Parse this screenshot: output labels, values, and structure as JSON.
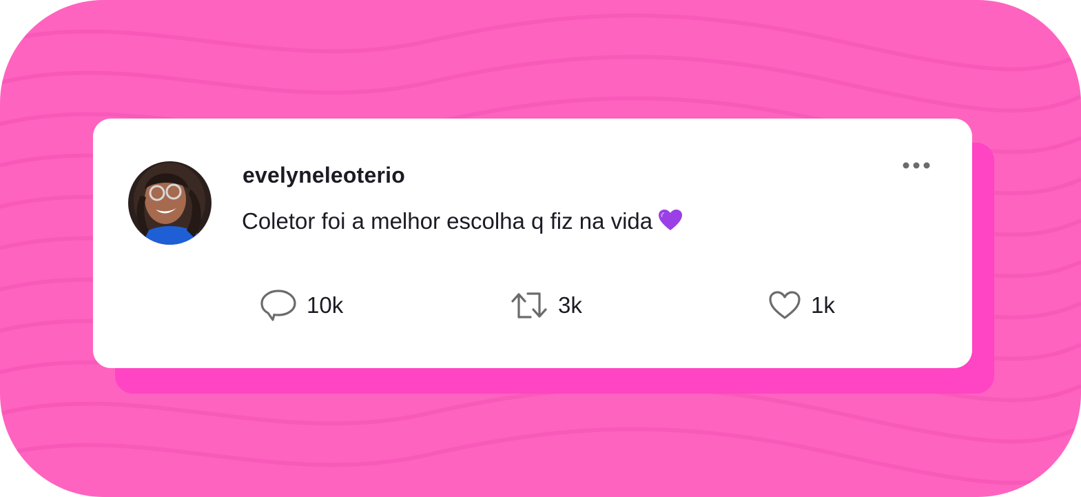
{
  "post": {
    "username": "evelyneleoterio",
    "text": "Coletor foi a melhor escolha q fiz na vida",
    "emoji_icon": "purple-heart-icon",
    "avatar_icon": "profile-photo",
    "more_icon": "more-options-icon"
  },
  "actions": {
    "replies": {
      "icon": "comment-icon",
      "count": "10k"
    },
    "reposts": {
      "icon": "repost-icon",
      "count": "3k"
    },
    "likes": {
      "icon": "heart-icon",
      "count": "1k"
    }
  },
  "colors": {
    "background": "#ff63c0",
    "card_shadow": "#ff44c4",
    "card": "#ffffff",
    "text": "#1b1b24",
    "icon": "#6b6b6b",
    "emoji": "#9b3fe6"
  }
}
